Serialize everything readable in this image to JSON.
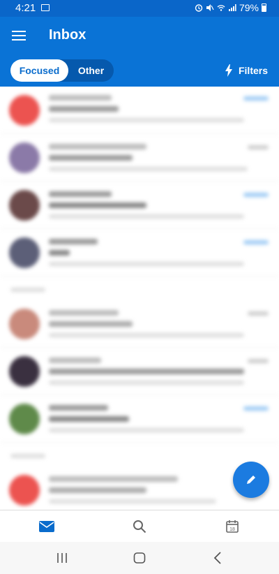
{
  "status_bar": {
    "time": "4:21",
    "battery": "79%"
  },
  "header": {
    "title": "Inbox",
    "filters_label": "Filters"
  },
  "tabs": [
    {
      "label": "Focused"
    },
    {
      "label": "Other"
    }
  ],
  "colors": {
    "brand": "#0a73d6",
    "status_bar": "#0a66c9",
    "fab": "#1b7be0"
  },
  "icons": [
    "hamburger-icon",
    "lightning-icon",
    "mail-icon",
    "search-icon",
    "calendar-icon",
    "compose-icon",
    "recent-apps-icon",
    "home-icon",
    "back-icon"
  ],
  "calendar_day": "18"
}
